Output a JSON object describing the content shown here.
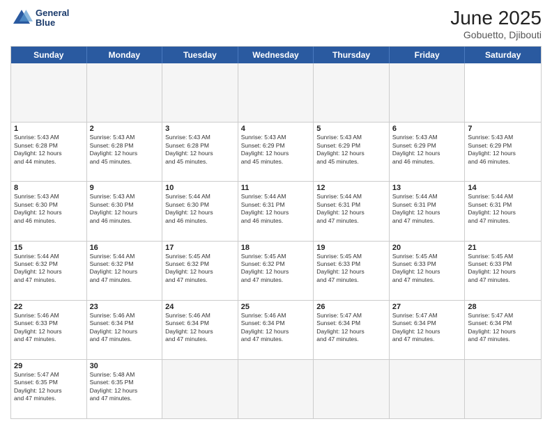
{
  "header": {
    "logo_line1": "General",
    "logo_line2": "Blue",
    "title": "June 2025",
    "subtitle": "Gobuetto, Djibouti"
  },
  "calendar": {
    "days_of_week": [
      "Sunday",
      "Monday",
      "Tuesday",
      "Wednesday",
      "Thursday",
      "Friday",
      "Saturday"
    ],
    "weeks": [
      [
        {
          "day": "",
          "empty": true
        },
        {
          "day": "",
          "empty": true
        },
        {
          "day": "",
          "empty": true
        },
        {
          "day": "",
          "empty": true
        },
        {
          "day": "",
          "empty": true
        },
        {
          "day": "",
          "empty": true
        },
        {
          "day": ""
        }
      ],
      [
        {
          "day": "1",
          "info": "Sunrise: 5:43 AM\nSunset: 6:28 PM\nDaylight: 12 hours\nand 44 minutes."
        },
        {
          "day": "2",
          "info": "Sunrise: 5:43 AM\nSunset: 6:28 PM\nDaylight: 12 hours\nand 45 minutes."
        },
        {
          "day": "3",
          "info": "Sunrise: 5:43 AM\nSunset: 6:28 PM\nDaylight: 12 hours\nand 45 minutes."
        },
        {
          "day": "4",
          "info": "Sunrise: 5:43 AM\nSunset: 6:29 PM\nDaylight: 12 hours\nand 45 minutes."
        },
        {
          "day": "5",
          "info": "Sunrise: 5:43 AM\nSunset: 6:29 PM\nDaylight: 12 hours\nand 45 minutes."
        },
        {
          "day": "6",
          "info": "Sunrise: 5:43 AM\nSunset: 6:29 PM\nDaylight: 12 hours\nand 46 minutes."
        },
        {
          "day": "7",
          "info": "Sunrise: 5:43 AM\nSunset: 6:29 PM\nDaylight: 12 hours\nand 46 minutes."
        }
      ],
      [
        {
          "day": "8",
          "info": "Sunrise: 5:43 AM\nSunset: 6:30 PM\nDaylight: 12 hours\nand 46 minutes."
        },
        {
          "day": "9",
          "info": "Sunrise: 5:43 AM\nSunset: 6:30 PM\nDaylight: 12 hours\nand 46 minutes."
        },
        {
          "day": "10",
          "info": "Sunrise: 5:44 AM\nSunset: 6:30 PM\nDaylight: 12 hours\nand 46 minutes."
        },
        {
          "day": "11",
          "info": "Sunrise: 5:44 AM\nSunset: 6:31 PM\nDaylight: 12 hours\nand 46 minutes."
        },
        {
          "day": "12",
          "info": "Sunrise: 5:44 AM\nSunset: 6:31 PM\nDaylight: 12 hours\nand 47 minutes."
        },
        {
          "day": "13",
          "info": "Sunrise: 5:44 AM\nSunset: 6:31 PM\nDaylight: 12 hours\nand 47 minutes."
        },
        {
          "day": "14",
          "info": "Sunrise: 5:44 AM\nSunset: 6:31 PM\nDaylight: 12 hours\nand 47 minutes."
        }
      ],
      [
        {
          "day": "15",
          "info": "Sunrise: 5:44 AM\nSunset: 6:32 PM\nDaylight: 12 hours\nand 47 minutes."
        },
        {
          "day": "16",
          "info": "Sunrise: 5:44 AM\nSunset: 6:32 PM\nDaylight: 12 hours\nand 47 minutes."
        },
        {
          "day": "17",
          "info": "Sunrise: 5:45 AM\nSunset: 6:32 PM\nDaylight: 12 hours\nand 47 minutes."
        },
        {
          "day": "18",
          "info": "Sunrise: 5:45 AM\nSunset: 6:32 PM\nDaylight: 12 hours\nand 47 minutes."
        },
        {
          "day": "19",
          "info": "Sunrise: 5:45 AM\nSunset: 6:33 PM\nDaylight: 12 hours\nand 47 minutes."
        },
        {
          "day": "20",
          "info": "Sunrise: 5:45 AM\nSunset: 6:33 PM\nDaylight: 12 hours\nand 47 minutes."
        },
        {
          "day": "21",
          "info": "Sunrise: 5:45 AM\nSunset: 6:33 PM\nDaylight: 12 hours\nand 47 minutes."
        }
      ],
      [
        {
          "day": "22",
          "info": "Sunrise: 5:46 AM\nSunset: 6:33 PM\nDaylight: 12 hours\nand 47 minutes."
        },
        {
          "day": "23",
          "info": "Sunrise: 5:46 AM\nSunset: 6:34 PM\nDaylight: 12 hours\nand 47 minutes."
        },
        {
          "day": "24",
          "info": "Sunrise: 5:46 AM\nSunset: 6:34 PM\nDaylight: 12 hours\nand 47 minutes."
        },
        {
          "day": "25",
          "info": "Sunrise: 5:46 AM\nSunset: 6:34 PM\nDaylight: 12 hours\nand 47 minutes."
        },
        {
          "day": "26",
          "info": "Sunrise: 5:47 AM\nSunset: 6:34 PM\nDaylight: 12 hours\nand 47 minutes."
        },
        {
          "day": "27",
          "info": "Sunrise: 5:47 AM\nSunset: 6:34 PM\nDaylight: 12 hours\nand 47 minutes."
        },
        {
          "day": "28",
          "info": "Sunrise: 5:47 AM\nSunset: 6:34 PM\nDaylight: 12 hours\nand 47 minutes."
        }
      ],
      [
        {
          "day": "29",
          "info": "Sunrise: 5:47 AM\nSunset: 6:35 PM\nDaylight: 12 hours\nand 47 minutes."
        },
        {
          "day": "30",
          "info": "Sunrise: 5:48 AM\nSunset: 6:35 PM\nDaylight: 12 hours\nand 47 minutes."
        },
        {
          "day": "",
          "empty": true
        },
        {
          "day": "",
          "empty": true
        },
        {
          "day": "",
          "empty": true
        },
        {
          "day": "",
          "empty": true
        },
        {
          "day": "",
          "empty": true
        }
      ]
    ]
  }
}
